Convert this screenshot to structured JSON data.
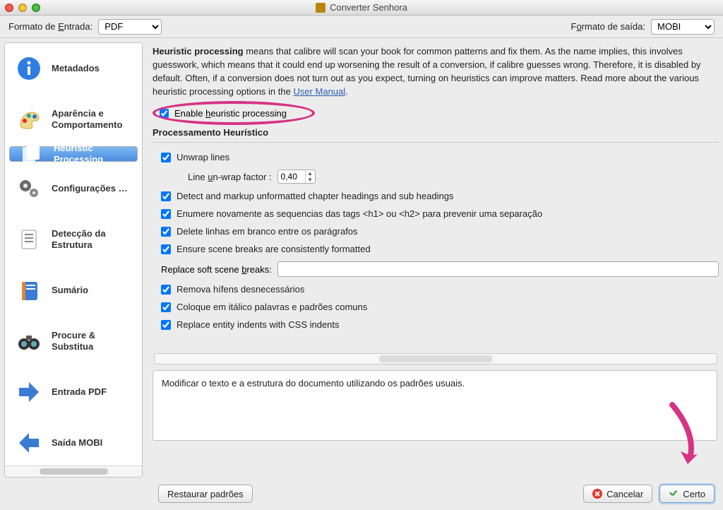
{
  "window": {
    "title": "Converter Senhora"
  },
  "formats": {
    "input_label_pre": "Formato de ",
    "input_label_u": "E",
    "input_label_post": "ntrada:",
    "input_value": "PDF",
    "output_label_pre": "F",
    "output_label_u": "o",
    "output_label_post": "rmato de saída:",
    "output_value": "MOBI"
  },
  "sidebar": {
    "items": [
      {
        "id": "metadata",
        "label": "Metadados"
      },
      {
        "id": "look-feel",
        "label": "Aparência e Comportamento"
      },
      {
        "id": "heuristic",
        "label": "Heuristic Processing"
      },
      {
        "id": "page-setup",
        "label": "Configurações …"
      },
      {
        "id": "structure",
        "label": "Detecção da Estrutura"
      },
      {
        "id": "toc",
        "label": "Sumário"
      },
      {
        "id": "search-replace",
        "label": "Procure & Substitua"
      },
      {
        "id": "input-pdf",
        "label": "Entrada PDF"
      },
      {
        "id": "output-mobi",
        "label": "Saída MOBI"
      }
    ]
  },
  "description": {
    "bold": "Heuristic processing",
    "body": " means that calibre will scan your book for common patterns and fix them. As the name implies, this involves guesswork, which means that it could end up worsening the result of a conversion, if calibre guesses wrong. Therefore, it is disabled by default. Often, if a conversion does not turn out as you expect, turning on heuristics can improve matters. Read more about the various heuristic processing options in the ",
    "link": "User Manual",
    "tail": "."
  },
  "enable": {
    "label_pre": "Enable ",
    "label_u": "h",
    "label_post": "euristic processing",
    "checked": true
  },
  "group_title": "Processamento Heurístico",
  "options": {
    "unwrap": {
      "label": "Unwrap lines",
      "checked": true
    },
    "unwrap_factor_label_pre": "Line ",
    "unwrap_factor_label_u": "u",
    "unwrap_factor_label_mid": "n-wrap factor :",
    "unwrap_factor_value": "0,40",
    "detect_chapters": {
      "label": "Detect and markup unformatted chapter headings and sub headings",
      "checked": true
    },
    "renumber": {
      "label": "Enumere novamente as sequencias das tags <h1> ou <h2> para prevenir uma separação",
      "checked": true
    },
    "delete_blank": {
      "label": "Delete linhas em branco entre os parágrafos",
      "checked": true
    },
    "scene_breaks": {
      "label": "Ensure scene breaks are consistently formatted",
      "checked": true
    },
    "replace_soft_label_pre": "Replace soft scene ",
    "replace_soft_label_u": "b",
    "replace_soft_label_post": "reaks:",
    "replace_soft_value": "",
    "remove_hyphens": {
      "label": "Remova hífens desnecessários",
      "checked": true
    },
    "italicize": {
      "label": "Coloque em itálico palavras e padrões comuns",
      "checked": true
    },
    "entity_indents": {
      "label": "Replace entity indents with CSS indents",
      "checked": true
    }
  },
  "info_text": "Modificar o texto e a estrutura do documento utilizando os padrões usuais.",
  "footer": {
    "restore": "Restaurar padrões",
    "cancel": "Cancelar",
    "ok": "Certo"
  }
}
